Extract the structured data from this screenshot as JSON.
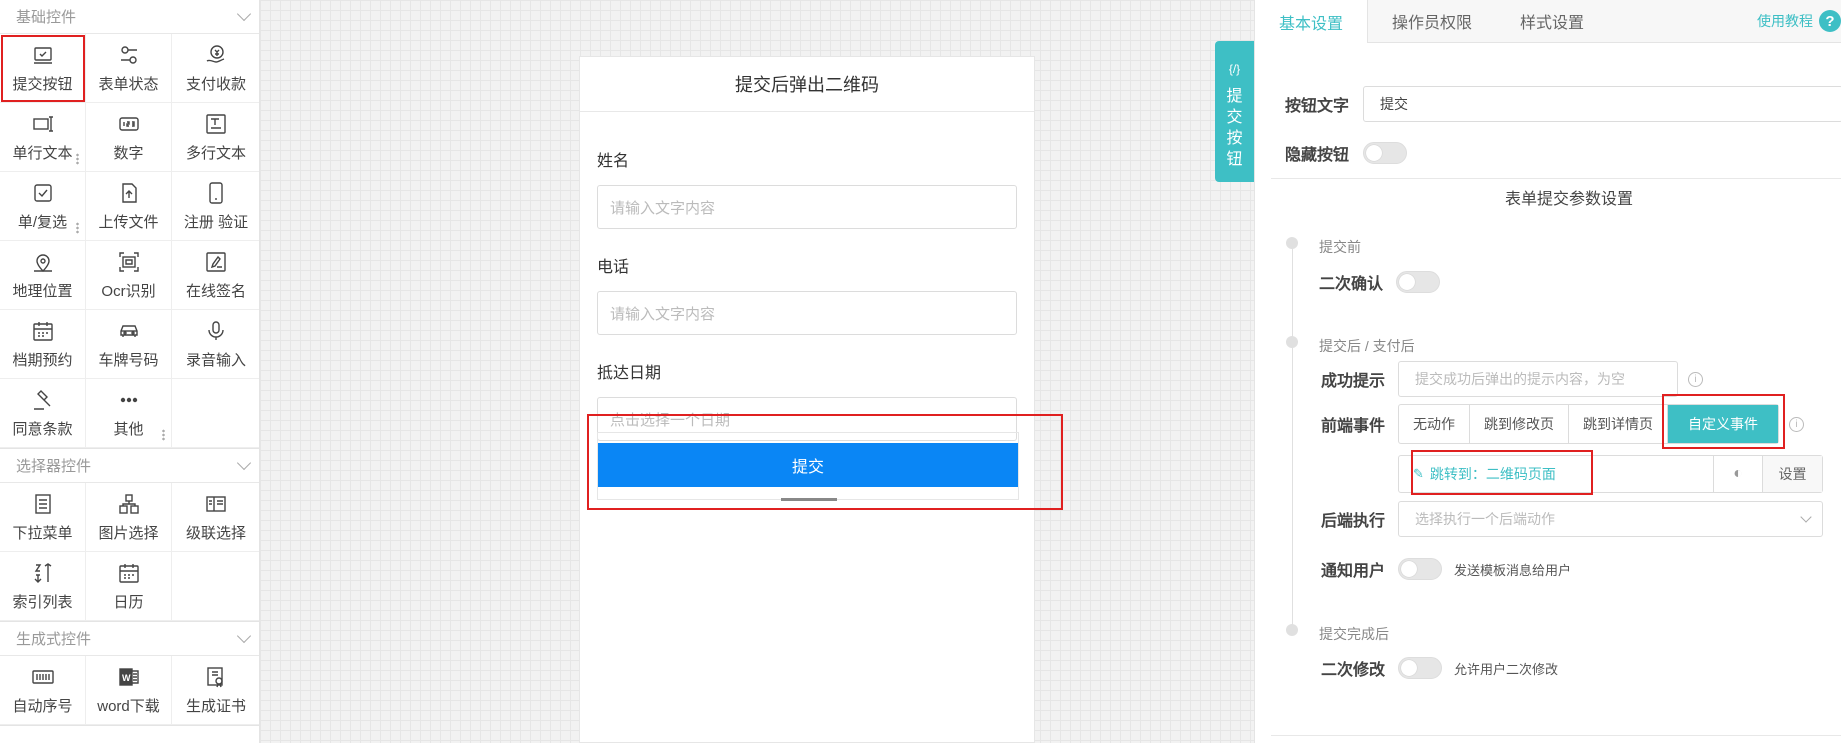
{
  "palette": {
    "basic": {
      "title": "基础控件",
      "items": [
        {
          "label": "提交按钮",
          "icon": "submit-icon"
        },
        {
          "label": "表单状态",
          "icon": "status-icon"
        },
        {
          "label": "支付收款",
          "icon": "payment-icon"
        },
        {
          "label": "单行文本",
          "icon": "single-text-icon"
        },
        {
          "label": "数字",
          "icon": "number-icon"
        },
        {
          "label": "多行文本",
          "icon": "multiline-text-icon"
        },
        {
          "label": "单/复选",
          "icon": "checkbox-icon"
        },
        {
          "label": "上传文件",
          "icon": "upload-icon"
        },
        {
          "label": "注册 验证",
          "icon": "phone-icon"
        },
        {
          "label": "地理位置",
          "icon": "location-icon"
        },
        {
          "label": "Ocr识别",
          "icon": "ocr-icon"
        },
        {
          "label": "在线签名",
          "icon": "signature-icon"
        },
        {
          "label": "档期预约",
          "icon": "calendar-icon"
        },
        {
          "label": "车牌号码",
          "icon": "car-icon"
        },
        {
          "label": "录音输入",
          "icon": "microphone-icon"
        },
        {
          "label": "同意条款",
          "icon": "gavel-icon"
        },
        {
          "label": "其他",
          "icon": "more-icon"
        }
      ]
    },
    "selector": {
      "title": "选择器控件",
      "items": [
        {
          "label": "下拉菜单",
          "icon": "dropdown-icon"
        },
        {
          "label": "图片选择",
          "icon": "image-select-icon"
        },
        {
          "label": "级联选择",
          "icon": "cascade-icon"
        },
        {
          "label": "索引列表",
          "icon": "sort-icon"
        },
        {
          "label": "日历",
          "icon": "calendar-icon"
        }
      ]
    },
    "generate": {
      "title": "生成式控件",
      "items": [
        {
          "label": "自动序号",
          "icon": "barcode-icon"
        },
        {
          "label": "word下载",
          "icon": "word-icon"
        },
        {
          "label": "生成证书",
          "icon": "certificate-icon"
        }
      ]
    }
  },
  "form": {
    "title": "提交后弹出二维码",
    "fields": [
      {
        "label": "姓名",
        "placeholder": "请输入文字内容"
      },
      {
        "label": "电话",
        "placeholder": "请输入文字内容"
      },
      {
        "label": "抵达日期",
        "placeholder": "点击选择一个日期"
      }
    ],
    "submit_label": "提交"
  },
  "side_tab": {
    "code": "{/}",
    "label": "提交按钮"
  },
  "panel": {
    "tabs": [
      "基本设置",
      "操作员权限",
      "样式设置"
    ],
    "help": "使用教程",
    "button_text_label": "按钮文字",
    "button_text_value": "提交",
    "hide_button_label": "隐藏按钮",
    "section_title": "表单提交参数设置",
    "before_label": "提交前",
    "confirm_label": "二次确认",
    "after_label": "提交后 / 支付后",
    "success_label": "成功提示",
    "success_placeholder": "提交成功后弹出的提示内容，为空",
    "frontend_label": "前端事件",
    "frontend_options": [
      "无动作",
      "跳到修改页",
      "跳到详情页",
      "自定义事件"
    ],
    "jump_text": "跳转到：二维码页面",
    "settings_btn": "设置",
    "backend_label": "后端执行",
    "backend_placeholder": "选择执行一个后端动作",
    "notify_label": "通知用户",
    "notify_hint": "发送模板消息给用户",
    "complete_label": "提交完成后",
    "modify_label": "二次修改",
    "modify_hint": "允许用户二次修改"
  }
}
